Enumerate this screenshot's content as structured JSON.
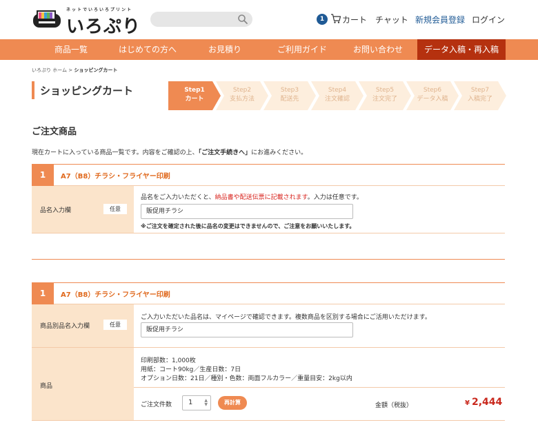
{
  "header": {
    "logo_tagline": "ネットでいろいろプリント",
    "logo_text": "いろぷり",
    "search": {
      "placeholder": "",
      "icon": "search-icon"
    },
    "cart_count": "1",
    "cart_label": "カート",
    "chat_label": "チャット",
    "register_label": "新規会員登録",
    "login_label": "ログイン"
  },
  "nav": {
    "items": [
      "商品一覧",
      "はじめての方へ",
      "お見積り",
      "ご利用ガイド",
      "お問い合わせ",
      "データ入稿・再入稿"
    ]
  },
  "breadcrumb": {
    "home": "いろぷり ホーム",
    "separator": " > ",
    "current": "ショッピングカート"
  },
  "page_title": "ショッピングカート",
  "steps": [
    {
      "step": "Step1",
      "label": "カート",
      "active": true
    },
    {
      "step": "Step2",
      "label": "支払方法",
      "active": false
    },
    {
      "step": "Step3",
      "label": "配送先",
      "active": false
    },
    {
      "step": "Step4",
      "label": "注文確認",
      "active": false
    },
    {
      "step": "Step5",
      "label": "注文完了",
      "active": false
    },
    {
      "step": "Step6",
      "label": "データ入稿",
      "active": false
    },
    {
      "step": "Step7",
      "label": "入稿完了",
      "active": false
    }
  ],
  "section_title": "ご注文商品",
  "intro": {
    "before": "現在カートに入っている商品一覧です。内容をご確認の上、",
    "emphasis": "「ご注文手続きへ」",
    "after": "にお進みください。"
  },
  "item1": {
    "number": "1",
    "title": "A7（B8）チラシ・フライヤー印刷",
    "field_label": "品名入力欄",
    "optional_badge": "任意",
    "help_before": "品名をご入力いただくと、",
    "help_red": "納品書や配送伝票に記載されます",
    "help_after": "。入力は任意です。",
    "input_value": "販促用チラシ",
    "note": "※ご注文を確定された後に品名の変更はできませんので、ご注意をお願いいたします。"
  },
  "item2": {
    "number": "1",
    "title": "A7（B8）チラシ・フライヤー印刷",
    "field_label": "商品別品名入力欄",
    "optional_badge": "任意",
    "help": "ご入力いただいた品名は、マイページで確認できます。複数商品を区別する場合にご活用いただけます。",
    "input_value": "販促用チラシ",
    "product_label": "商品",
    "spec_lines": [
      "印刷部数：1,000枚",
      "用紙：コート90kg／生産日数：7日",
      "オプション日数：21日／種別・色数：両面フルカラー／重量目安：2kg以内"
    ],
    "qty_label": "ご注文件数",
    "qty_value": "1",
    "recalc_label": "再計算",
    "price_label": "金額（税抜）",
    "price_currency": "¥",
    "price_value": "2,444"
  },
  "colors": {
    "accent": "#ef8a52",
    "accent_dark": "#b5310f",
    "label_bg": "#fbe4cb",
    "price_red": "#c9281d",
    "link_blue": "#1f5a95"
  }
}
